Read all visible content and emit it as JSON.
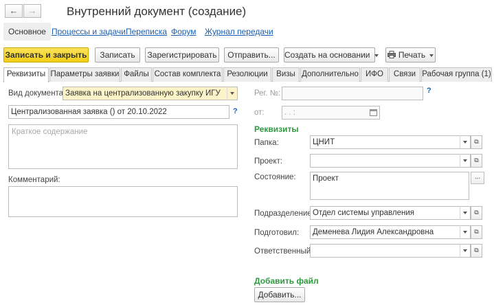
{
  "window": {
    "back_icon": "←",
    "forward_icon": "→",
    "title": "Внутренний документ (создание)"
  },
  "sections": [
    {
      "label": "Основное"
    },
    {
      "label": "Процессы и задачи"
    },
    {
      "label": "Переписка"
    },
    {
      "label": "Форум"
    },
    {
      "label": "Журнал передачи"
    }
  ],
  "toolbar": {
    "save_close": "Записать и закрыть",
    "save": "Записать",
    "register": "Зарегистрировать",
    "send": "Отправить...",
    "create_based": "Создать на основании",
    "print": "Печать",
    "printer_icon": "printer-icon"
  },
  "tabs": [
    {
      "label": "Реквизиты"
    },
    {
      "label": "Параметры заявки"
    },
    {
      "label": "Файлы"
    },
    {
      "label": "Состав комплекта"
    },
    {
      "label": "Резолюции"
    },
    {
      "label": "Визы"
    },
    {
      "label": "Дополнительно"
    },
    {
      "label": "ИФО"
    },
    {
      "label": "Связи"
    },
    {
      "label": "Рабочая группа (1)"
    }
  ],
  "form": {
    "doc_type_label": "Вид документа:",
    "doc_type_value": "Заявка на централизованную закупку ИГУ",
    "subject_value": "Централизованная заявка () от 20.10.2022",
    "summary_placeholder": "Краткое содержание",
    "comment_label": "Комментарий:",
    "reg_no_label": "Рег. №:",
    "reg_from_label": "от:",
    "reg_from_value": ". .       :",
    "help_mark": "?",
    "details_header": "Реквизиты",
    "folder_label": "Папка:",
    "folder_value": "ЦНИТ",
    "project_label": "Проект:",
    "project_value": "",
    "state_label": "Состояние:",
    "state_value": "Проект",
    "state_btn": "...",
    "dept_label": "Подразделение:",
    "dept_value": "Отдел системы управления",
    "prepared_label": "Подготовил:",
    "prepared_value": "Деменева Лидия Александровна",
    "responsible_label": "Ответственный:",
    "responsible_value": "",
    "add_file_header": "Добавить файл",
    "add_button": "Добавить...",
    "open_icon": "⧉"
  }
}
